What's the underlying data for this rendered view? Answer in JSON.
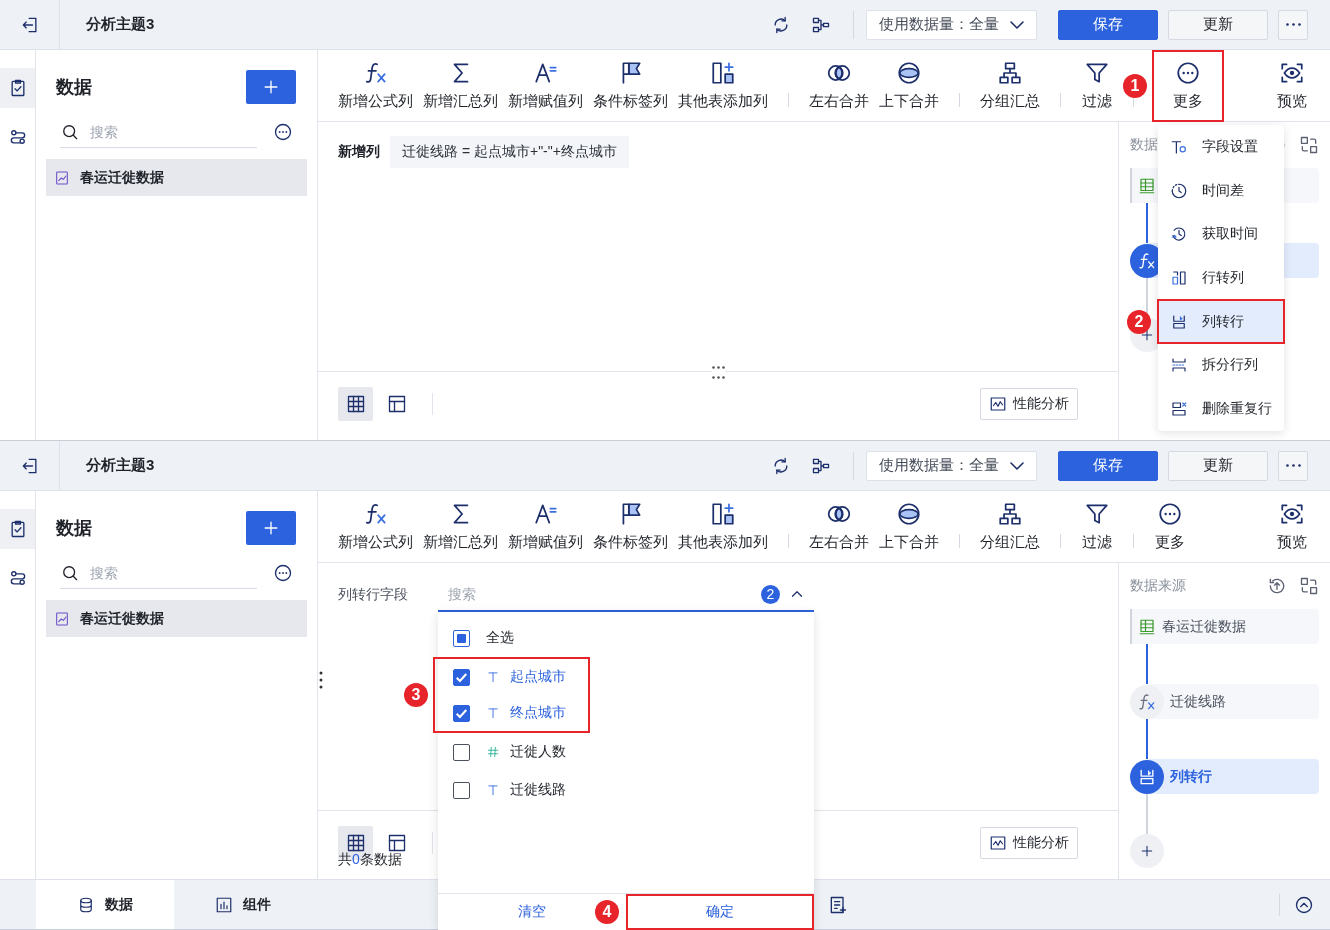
{
  "panels": [
    {
      "header": {
        "title": "分析主题3",
        "data_amount": "使用数据量：全量",
        "save": "保存",
        "update": "更新"
      },
      "rail": [
        {
          "kind": "model",
          "selected": true
        },
        {
          "kind": "flow",
          "selected": false
        }
      ],
      "sidebar": {
        "title": "数据",
        "search": {
          "placeholder": "搜索"
        },
        "items": [
          {
            "label": "春运迁徙数据",
            "selected": true
          }
        ],
        "resize_handle": false
      },
      "toolbar": {
        "groups": [
          [
            {
              "label": "新增公式列",
              "kind": "formula",
              "highlighted": false
            },
            {
              "label": "新增汇总列",
              "kind": "sum",
              "highlighted": false
            },
            {
              "label": "新增赋值列",
              "kind": "assign",
              "highlighted": false
            },
            {
              "label": "条件标签列",
              "kind": "tag",
              "highlighted": false
            },
            {
              "label": "其他表添加列",
              "kind": "append",
              "highlighted": false
            }
          ],
          [
            {
              "label": "左右合并",
              "kind": "join_lr",
              "highlighted": false
            },
            {
              "label": "上下合并",
              "kind": "join_ud",
              "highlighted": false
            }
          ],
          [
            {
              "label": "分组汇总",
              "kind": "group",
              "highlighted": false
            }
          ],
          [
            {
              "label": "过滤",
              "kind": "filter",
              "highlighted": false
            }
          ],
          [
            {
              "label": "更多",
              "kind": "more",
              "highlighted": true,
              "annotation": "1"
            }
          ]
        ],
        "end": {
          "label": "预览",
          "kind": "preview",
          "highlighted": false
        }
      },
      "content": {
        "kind": "new_column",
        "label": "新增列",
        "formula": "迁徙线路 = 起点城市+\"-\"+终点城市"
      },
      "split_handle": true,
      "views": [
        {
          "kind": "grid",
          "selected": true
        },
        {
          "kind": "layout",
          "selected": false
        }
      ],
      "analysis_button": "性能分析",
      "flow": {
        "title": "数据",
        "nodes": [
          {
            "kind": "source",
            "active": false
          },
          {
            "kind": "formula",
            "active": true
          },
          {
            "kind": "add",
            "active": false
          }
        ]
      },
      "menu": {
        "items": [
          {
            "label": "字段设置",
            "kind": "field",
            "selected": false,
            "highlighted": false
          },
          {
            "label": "时间差",
            "kind": "timediff",
            "selected": false,
            "highlighted": false
          },
          {
            "label": "获取时间",
            "kind": "gettime",
            "selected": false,
            "highlighted": false
          },
          {
            "label": "行转列",
            "kind": "row2col",
            "selected": false,
            "highlighted": false
          },
          {
            "label": "列转行",
            "kind": "col2row",
            "selected": true,
            "highlighted": true,
            "annotation": "2"
          },
          {
            "label": "拆分行列",
            "kind": "split",
            "selected": false,
            "highlighted": false
          },
          {
            "label": "删除重复行",
            "kind": "dedupe",
            "selected": false,
            "highlighted": false
          }
        ]
      }
    },
    {
      "header": {
        "title": "分析主题3",
        "data_amount": "使用数据量：全量",
        "save": "保存",
        "update": "更新"
      },
      "rail": [
        {
          "kind": "model",
          "selected": true
        },
        {
          "kind": "flow",
          "selected": false
        }
      ],
      "sidebar": {
        "title": "数据",
        "search": {
          "placeholder": "搜索"
        },
        "items": [
          {
            "label": "春运迁徙数据",
            "selected": true
          }
        ],
        "resize_handle": true
      },
      "toolbar": {
        "groups": [
          [
            {
              "label": "新增公式列",
              "kind": "formula",
              "highlighted": false
            },
            {
              "label": "新增汇总列",
              "kind": "sum",
              "highlighted": false
            },
            {
              "label": "新增赋值列",
              "kind": "assign",
              "highlighted": false
            },
            {
              "label": "条件标签列",
              "kind": "tag",
              "highlighted": false
            },
            {
              "label": "其他表添加列",
              "kind": "append",
              "highlighted": false
            }
          ],
          [
            {
              "label": "左右合并",
              "kind": "join_lr",
              "highlighted": false
            },
            {
              "label": "上下合并",
              "kind": "join_ud",
              "highlighted": false
            }
          ],
          [
            {
              "label": "分组汇总",
              "kind": "group",
              "highlighted": false
            }
          ],
          [
            {
              "label": "过滤",
              "kind": "filter",
              "highlighted": false
            }
          ],
          [
            {
              "label": "更多",
              "kind": "more",
              "highlighted": false
            }
          ]
        ],
        "end": {
          "label": "预览",
          "kind": "preview",
          "highlighted": false
        }
      },
      "content": {
        "kind": "field_picker",
        "label": "列转行字段",
        "search": {
          "placeholder": "搜索"
        },
        "count": "2",
        "dropdown": {
          "select_all": {
            "label": "全选",
            "checked": false,
            "indeterminate": true
          },
          "annotation": "3",
          "options": [
            {
              "label": "起点城市",
              "kind": "text",
              "checked": true,
              "highlighted": true
            },
            {
              "label": "终点城市",
              "kind": "text",
              "checked": true,
              "highlighted": true
            },
            {
              "label": "迁徙人数",
              "kind": "number",
              "checked": false,
              "highlighted": false
            },
            {
              "label": "迁徙线路",
              "kind": "text",
              "checked": false,
              "highlighted": false
            }
          ],
          "clear": {
            "label": "清空",
            "highlighted": false
          },
          "confirm": {
            "label": "确定",
            "highlighted": true,
            "annotation": "4"
          }
        }
      },
      "split_handle": false,
      "views": [
        {
          "kind": "grid",
          "selected": true
        },
        {
          "kind": "layout",
          "selected": false
        }
      ],
      "record_count": {
        "prefix": "共",
        "count": "0",
        "suffix": "条数据"
      },
      "analysis_button": "性能分析",
      "flow": {
        "title": "数据来源",
        "nodes": [
          {
            "kind": "source",
            "label": "春运迁徙数据",
            "active": false
          },
          {
            "kind": "formula",
            "label": "迁徙线路",
            "active": false
          },
          {
            "kind": "col2row",
            "label": "列转行",
            "active": true
          },
          {
            "kind": "add",
            "active": false
          }
        ]
      },
      "bottom_tabs": [
        {
          "label": "数据",
          "kind": "data",
          "selected": true
        },
        {
          "label": "组件",
          "kind": "widget",
          "selected": false
        }
      ]
    }
  ]
}
